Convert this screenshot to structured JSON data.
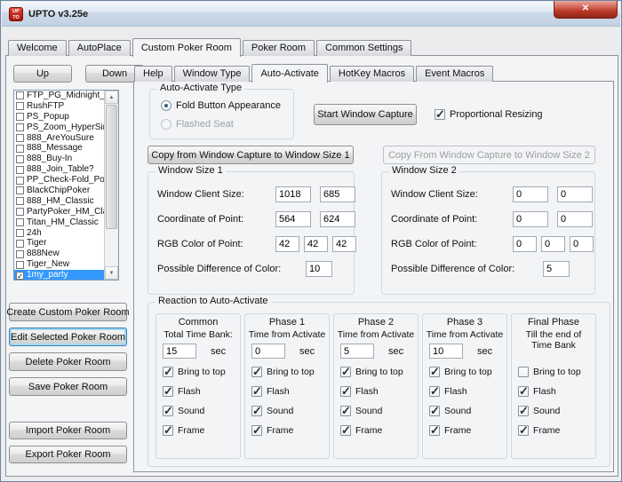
{
  "window": {
    "title": "UPTO  v3.25e",
    "logo": {
      "top": "UP",
      "bottom": "TO"
    }
  },
  "icons": {
    "close": "✕",
    "scroll_up": "▲",
    "scroll_down": "▼"
  },
  "colors": {
    "selection_blue": "#3399ff",
    "close_red": "#bb3a28",
    "logo_red": "#b81408",
    "focus_ring": "#3c7fb1"
  },
  "main_tabs": [
    "Welcome",
    "AutoPlace",
    "Custom Poker Room",
    "Poker Room",
    "Common Settings"
  ],
  "main_tabs_active_index": 2,
  "inner_tabs": [
    "Help",
    "Window Type",
    "Auto-Activate",
    "HotKey Macros",
    "Event Macros"
  ],
  "inner_tabs_active_index": 2,
  "left_panel": {
    "up_label": "Up",
    "down_label": "Down",
    "rooms": [
      {
        "label": "FTP_PG_Midnight_F",
        "checked": false,
        "selected": false
      },
      {
        "label": "RushFTP",
        "checked": false,
        "selected": false
      },
      {
        "label": "PS_Popup",
        "checked": false,
        "selected": false
      },
      {
        "label": "PS_Zoom_HyperSim",
        "checked": false,
        "selected": false
      },
      {
        "label": "888_AreYouSure",
        "checked": false,
        "selected": false
      },
      {
        "label": "888_Message",
        "checked": false,
        "selected": false
      },
      {
        "label": "888_Buy-In",
        "checked": false,
        "selected": false
      },
      {
        "label": "888_Join_Table?",
        "checked": false,
        "selected": false
      },
      {
        "label": "PP_Check-Fold_Pop",
        "checked": false,
        "selected": false
      },
      {
        "label": "BlackChipPoker",
        "checked": false,
        "selected": false
      },
      {
        "label": "888_HM_Classic",
        "checked": false,
        "selected": false
      },
      {
        "label": "PartyPoker_HM_Clas",
        "checked": false,
        "selected": false
      },
      {
        "label": "Titan_HM_Classic",
        "checked": false,
        "selected": false
      },
      {
        "label": "24h",
        "checked": false,
        "selected": false
      },
      {
        "label": "Tiger",
        "checked": false,
        "selected": false
      },
      {
        "label": "888New",
        "checked": false,
        "selected": false
      },
      {
        "label": "Tiger_New",
        "checked": false,
        "selected": false
      },
      {
        "label": "1my_party",
        "checked": true,
        "selected": true
      }
    ],
    "buttons": {
      "create": "Create Custom Poker Room",
      "edit": "Edit Selected Poker Room",
      "delete": "Delete Poker Room",
      "save": "Save Poker Room",
      "import": "Import Poker Room",
      "export": "Export Poker Room"
    }
  },
  "auto_activate": {
    "type_group": {
      "title": "Auto-Activate Type",
      "options": [
        {
          "label": "Fold Button Appearance",
          "selected": true,
          "enabled": true
        },
        {
          "label": "Flashed Seat",
          "selected": false,
          "enabled": false
        }
      ]
    },
    "start_capture_label": "Start Window Capture",
    "proportional": {
      "label": "Proportional Resizing",
      "checked": true
    },
    "copy_to_ws1_label": "Copy from Window Capture to Window Size 1",
    "copy_to_ws2_label": "Copy From Window Capture to Window Size 2",
    "window_size_1": {
      "title": "Window Size 1",
      "client_size_label": "Window Client Size:",
      "client_w": "1018",
      "client_h": "685",
      "coord_label": "Coordinate of Point:",
      "coord_x": "564",
      "coord_y": "624",
      "rgb_label": "RGB Color of Point:",
      "rgb": [
        "42",
        "42",
        "42"
      ],
      "diff_label": "Possible Difference of Color:",
      "diff": "10"
    },
    "window_size_2": {
      "title": "Window Size 2",
      "client_size_label": "Window Client Size:",
      "client_w": "0",
      "client_h": "0",
      "coord_label": "Coordinate of Point:",
      "coord_x": "0",
      "coord_y": "0",
      "rgb_label": "RGB Color of Point:",
      "rgb": [
        "0",
        "0",
        "0"
      ],
      "diff_label": "Possible Difference of Color:",
      "diff": "5"
    },
    "reaction": {
      "title": "Reaction to Auto-Activate",
      "columns": [
        {
          "name": "Common",
          "sub": [
            "Total Time Bank:"
          ],
          "value": "15",
          "unit": "sec",
          "checks": [
            {
              "label": "Bring to top",
              "checked": true
            },
            {
              "label": "Flash",
              "checked": true
            },
            {
              "label": "Sound",
              "checked": true
            },
            {
              "label": "Frame",
              "checked": true
            }
          ]
        },
        {
          "name": "Phase 1",
          "sub": [
            "Time from Activate"
          ],
          "value": "0",
          "unit": "sec",
          "checks": [
            {
              "label": "Bring to top",
              "checked": true
            },
            {
              "label": "Flash",
              "checked": true
            },
            {
              "label": "Sound",
              "checked": true
            },
            {
              "label": "Frame",
              "checked": true
            }
          ]
        },
        {
          "name": "Phase 2",
          "sub": [
            "Time from Activate"
          ],
          "value": "5",
          "unit": "sec",
          "checks": [
            {
              "label": "Bring to top",
              "checked": true
            },
            {
              "label": "Flash",
              "checked": true
            },
            {
              "label": "Sound",
              "checked": true
            },
            {
              "label": "Frame",
              "checked": true
            }
          ]
        },
        {
          "name": "Phase 3",
          "sub": [
            "Time from Activate"
          ],
          "value": "10",
          "unit": "sec",
          "checks": [
            {
              "label": "Bring to top",
              "checked": true
            },
            {
              "label": "Flash",
              "checked": true
            },
            {
              "label": "Sound",
              "checked": true
            },
            {
              "label": "Frame",
              "checked": true
            }
          ]
        },
        {
          "name": "Final Phase",
          "sub": [
            "Till the end of",
            "Time Bank"
          ],
          "value": null,
          "unit": null,
          "checks": [
            {
              "label": "Bring to top",
              "checked": false
            },
            {
              "label": "Flash",
              "checked": true
            },
            {
              "label": "Sound",
              "checked": true
            },
            {
              "label": "Frame",
              "checked": true
            }
          ]
        }
      ]
    }
  }
}
